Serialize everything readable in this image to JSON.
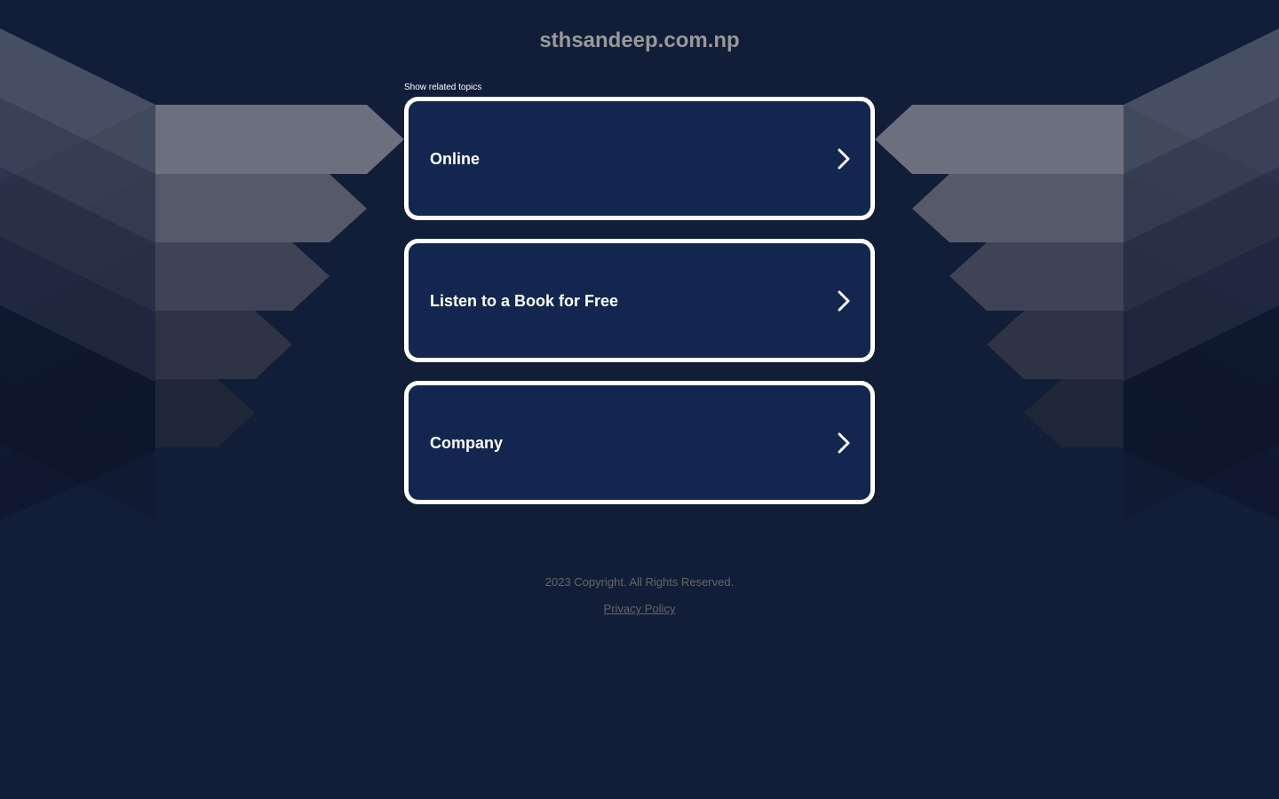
{
  "header": {
    "domain": "sthsandeep.com.np"
  },
  "related": {
    "label": "Show related topics",
    "topics": [
      {
        "label": "Online"
      },
      {
        "label": "Listen to a Book for Free"
      },
      {
        "label": "Company"
      }
    ]
  },
  "footer": {
    "copyright": "2023 Copyright. All Rights Reserved.",
    "privacy": "Privacy Policy"
  },
  "icons": {
    "topic_arrow": "chevron-right-icon"
  },
  "colors": {
    "background": "#121d38",
    "card_fill": "#12264f",
    "card_border": "#ffffff",
    "muted_text": "#666666",
    "title_text": "#999999"
  }
}
